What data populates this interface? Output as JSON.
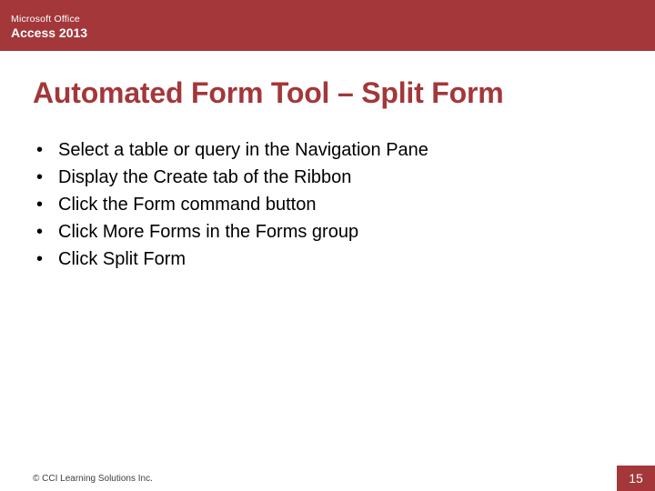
{
  "header": {
    "brand": "Microsoft Office",
    "product": "Access 2013"
  },
  "slide": {
    "title": "Automated Form Tool – Split Form",
    "bullets": [
      "Select a table or query in the Navigation Pane",
      "Display the Create tab of the Ribbon",
      "Click the Form command button",
      "Click More Forms in the Forms group",
      "Click Split Form"
    ]
  },
  "footer": {
    "copyright": "© CCI Learning Solutions Inc.",
    "page_number": "15"
  }
}
